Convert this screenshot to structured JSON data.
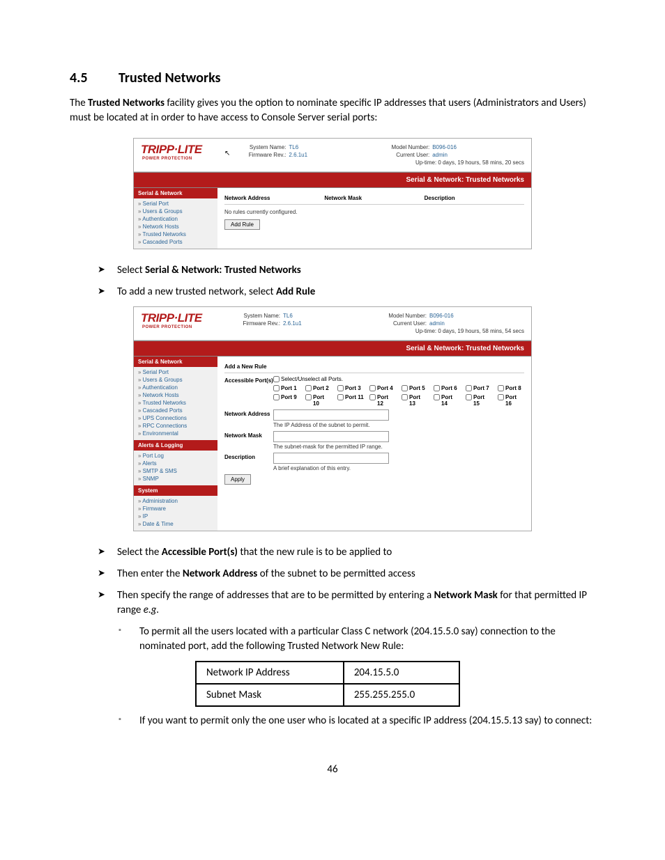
{
  "section": {
    "number": "4.5",
    "title": "Trusted Networks"
  },
  "intro_parts": {
    "p1": "The ",
    "b1": "Trusted Networks",
    "p2": " facility gives you the option to nominate specific IP addresses that users (Administrators and Users) must be located at in order to have access to Console Server serial ports:"
  },
  "hdr": {
    "logo": "TRIPP",
    "logo2": "LITE",
    "logo_sub": "POWER PROTECTION",
    "sysname_l": "System Name:",
    "sysname_v": "TL6",
    "fw_l": "Firmware Rev.:",
    "fw_v": "2.6.1u1",
    "model_l": "Model Number:",
    "model_v": "B096-016",
    "user_l": "Current User:",
    "user_v": "admin",
    "uptime1": "Up-time: 0 days, 19 hours, 58 mins, 20 secs",
    "uptime2": "Up-time: 0 days, 19 hours, 58 mins, 54 secs"
  },
  "bar_title": "Serial & Network: Trusted Networks",
  "nav1_title": "Serial & Network",
  "nav1": [
    "Serial Port",
    "Users & Groups",
    "Authentication",
    "Network Hosts",
    "Trusted Networks",
    "Cascaded Ports"
  ],
  "nav1b": [
    "Serial Port",
    "Users & Groups",
    "Authentication",
    "Network Hosts",
    "Trusted Networks",
    "Cascaded Ports",
    "UPS Connections",
    "RPC Connections",
    "Environmental"
  ],
  "nav2_title": "Alerts & Logging",
  "nav2": [
    "Port Log",
    "Alerts",
    "SMTP & SMS",
    "SNMP"
  ],
  "nav3_title": "System",
  "nav3": [
    "Administration",
    "Firmware",
    "IP",
    "Date & Time"
  ],
  "tbl": {
    "c1": "Network Address",
    "c2": "Network Mask",
    "c3": "Description"
  },
  "norules": "No rules currently configured.",
  "btn_add": "Add Rule",
  "bullets": {
    "b1a": "Select ",
    "b1b": "Serial & Network: Trusted Networks",
    "b2a": "To add a new trusted network, select ",
    "b2b": "Add Rule",
    "b3a": "Select the ",
    "b3b": "Accessible Port(s)",
    "b3c": " that the new rule is to be applied to",
    "b4a": "Then enter the ",
    "b4b": "Network Address",
    "b4c": " of the subnet to be permitted access",
    "b5a": "Then specify the range of addresses that are to be permitted by entering a ",
    "b5b": "Network Mask",
    "b5c": " for that permitted IP range ",
    "b5d": "e.g.",
    "sq1": "To permit all the users located with a particular Class C network (204.15.5.0 say) connection to the nominated port, add the following Trusted Network New Rule:",
    "sq2": "If you want to permit only the one user who is located at a specific IP address (204.15.5.13 say) to connect:"
  },
  "form": {
    "title": "Add a New Rule",
    "ports_lbl": "Accessible Port(s)",
    "sel_all": "Select/Unselect all Ports.",
    "port_word": "Port",
    "naddr_lbl": "Network Address",
    "naddr_hint": "The IP Address of the subnet to permit.",
    "nmask_lbl": "Network Mask",
    "nmask_hint": "The subnet-mask for the permitted IP range.",
    "desc_lbl": "Description",
    "desc_hint": "A brief explanation of this entry.",
    "apply": "Apply"
  },
  "example": {
    "r1c1": "Network IP Address",
    "r1c2": "204.15.5.0",
    "r2c1": "Subnet Mask",
    "r2c2": "255.255.255.0"
  },
  "page": "46"
}
